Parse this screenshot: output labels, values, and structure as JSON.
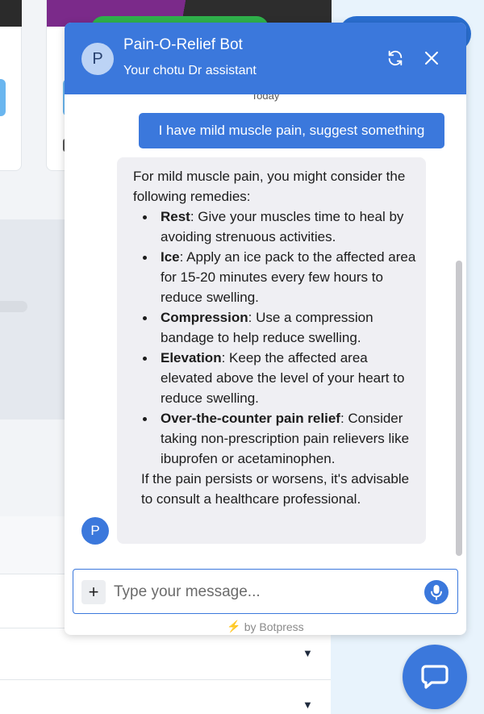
{
  "header": {
    "avatar_letter": "P",
    "bot_name": "Pain-O-Relief Bot",
    "bot_description": "Your chotu Dr assistant"
  },
  "conversation": {
    "date_separator": "Today",
    "user_message": "I have mild muscle pain, suggest something",
    "bot_avatar_letter": "P",
    "bot_reply": {
      "intro": "For mild muscle pain, you might consider the following remedies:",
      "items": [
        {
          "title": "Rest",
          "text": ": Give your muscles time to heal by avoiding strenuous activities."
        },
        {
          "title": "Ice",
          "text": ": Apply an ice pack to the affected area for 15-20 minutes every few hours to reduce swelling."
        },
        {
          "title": "Compression",
          "text": ": Use a compression bandage to help reduce swelling."
        },
        {
          "title": "Elevation",
          "text": ": Keep the affected area elevated above the level of your heart to reduce swelling."
        },
        {
          "title": "Over-the-counter pain relief",
          "text": ": Consider taking non-prescription pain relievers like ibuprofen or acetaminophen."
        }
      ],
      "closing": "If the pain persists or worsens, it's advisable to consult a healthcare professional."
    }
  },
  "composer": {
    "placeholder": "Type your message...",
    "plus_label": "+"
  },
  "footer": {
    "powered_by": "by Botpress"
  },
  "colors": {
    "primary": "#3b78dc",
    "bubble_bg": "#efeff3",
    "accent_bolt": "#f28b2d"
  },
  "background": {
    "table_carets": [
      "▼",
      "▼"
    ]
  }
}
